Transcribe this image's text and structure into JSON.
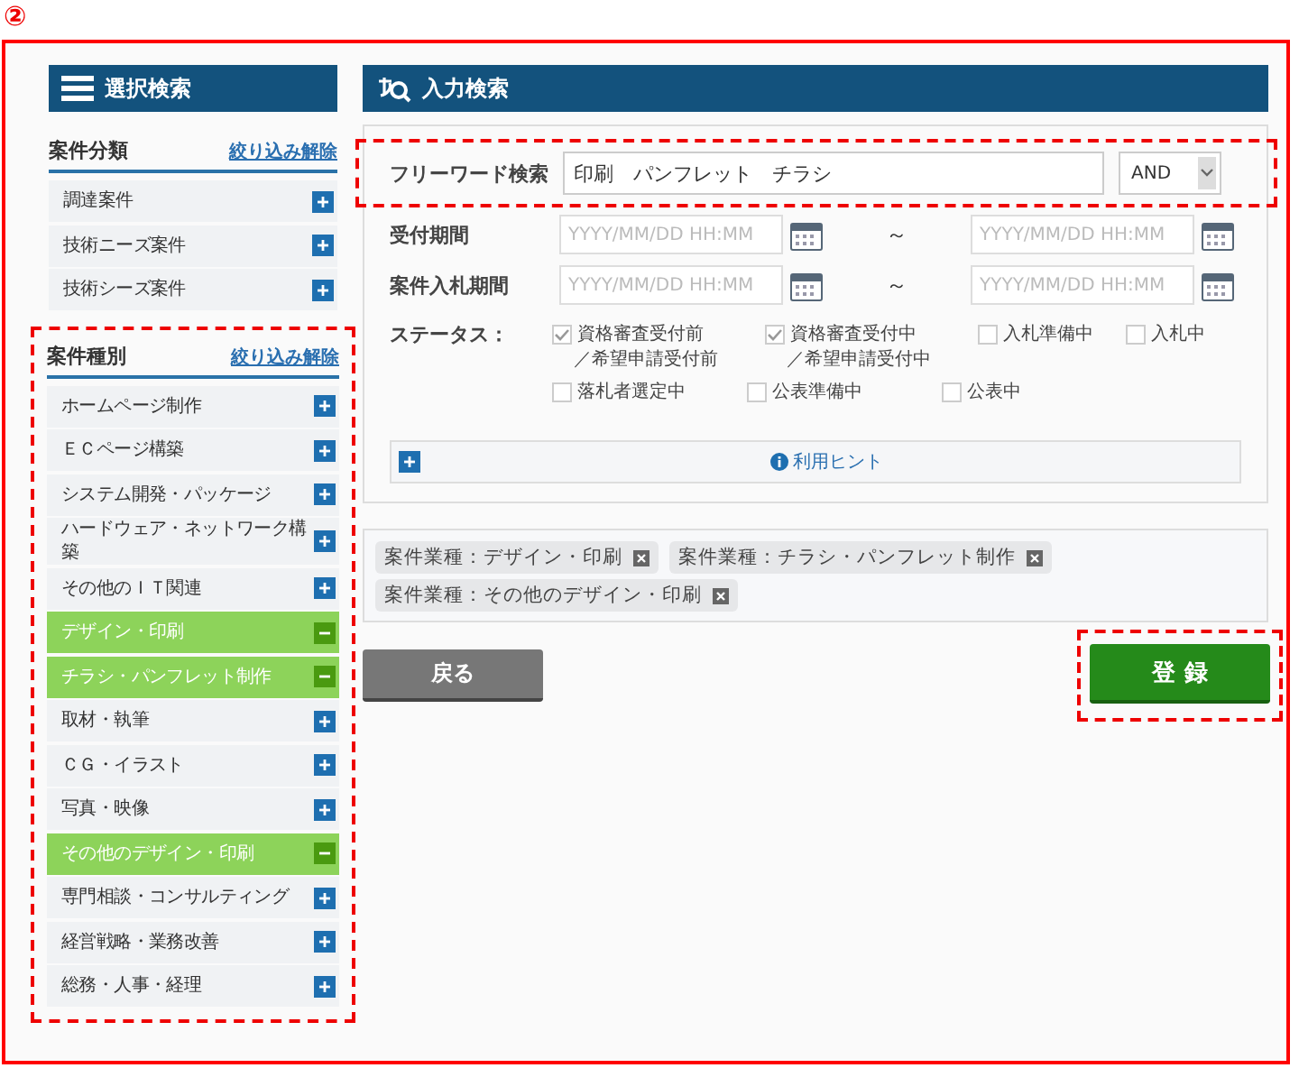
{
  "marker": "②",
  "sidebar": {
    "title": "選択検索",
    "sections": [
      {
        "title": "案件分類",
        "clear_link": "絞り込み解除",
        "highlighted": false,
        "items": [
          {
            "label": "調達案件",
            "selected": false
          },
          {
            "label": "技術ニーズ案件",
            "selected": false
          },
          {
            "label": "技術シーズ案件",
            "selected": false
          }
        ]
      },
      {
        "title": "案件種別",
        "clear_link": "絞り込み解除",
        "highlighted": true,
        "items": [
          {
            "label": "ホームページ制作",
            "selected": false
          },
          {
            "label": "ＥＣページ構築",
            "selected": false
          },
          {
            "label": "システム開発・パッケージ",
            "selected": false
          },
          {
            "label": "ハードウェア・ネットワーク構築",
            "selected": false
          },
          {
            "label": "その他のＩＴ関連",
            "selected": false
          },
          {
            "label": "デザイン・印刷",
            "selected": true
          },
          {
            "label": "チラシ・パンフレット制作",
            "selected": true
          },
          {
            "label": "取材・執筆",
            "selected": false
          },
          {
            "label": "ＣＧ・イラスト",
            "selected": false
          },
          {
            "label": "写真・映像",
            "selected": false
          },
          {
            "label": "その他のデザイン・印刷",
            "selected": true
          },
          {
            "label": "専門相談・コンサルティング",
            "selected": false
          },
          {
            "label": "経営戦略・業務改善",
            "selected": false
          },
          {
            "label": "総務・人事・経理",
            "selected": false
          }
        ]
      }
    ]
  },
  "main": {
    "title": "入力検索",
    "freeword": {
      "label": "フリーワード検索",
      "value": "印刷　パンフレット　チラシ",
      "operator": "AND"
    },
    "periods": [
      {
        "label": "受付期間",
        "from_placeholder": "YYYY/MM/DD HH:MM",
        "separator": "～",
        "to_placeholder": "YYYY/MM/DD HH:MM"
      },
      {
        "label": "案件入札期間",
        "from_placeholder": "YYYY/MM/DD HH:MM",
        "separator": "～",
        "to_placeholder": "YYYY/MM/DD HH:MM"
      }
    ],
    "status": {
      "label": "ステータス：",
      "options": [
        {
          "label": "資格審査受付前",
          "sub": "／希望申請受付前",
          "checked": true
        },
        {
          "label": "資格審査受付中",
          "sub": "／希望申請受付中",
          "checked": true
        },
        {
          "label": "入札準備中",
          "checked": false
        },
        {
          "label": "入札中",
          "checked": false
        },
        {
          "label": "落札者選定中",
          "checked": false
        },
        {
          "label": "公表準備中",
          "checked": false
        },
        {
          "label": "公表中",
          "checked": false
        }
      ]
    },
    "hint": "利用ヒント",
    "tags": [
      {
        "label": "案件業種：デザイン・印刷"
      },
      {
        "label": "案件業種：チラシ・パンフレット制作"
      },
      {
        "label": "案件業種：その他のデザイン・印刷"
      }
    ],
    "back_button": "戻る",
    "submit_button": "登 録"
  }
}
